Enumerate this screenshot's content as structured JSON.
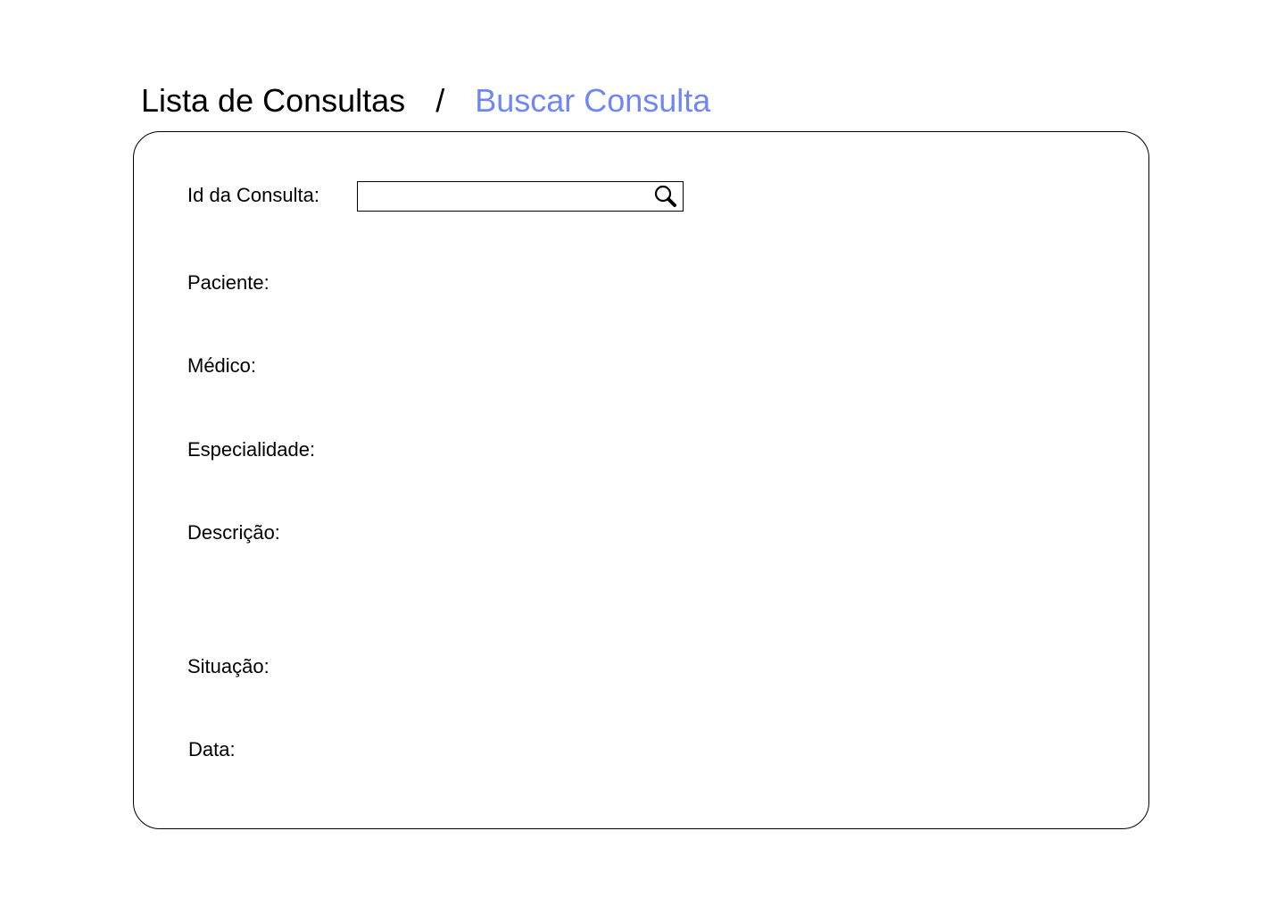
{
  "breadcrumb": {
    "root": "Lista de Consultas",
    "separator": "/",
    "current": "Buscar Consulta"
  },
  "form": {
    "id_label": "Id da Consulta:",
    "id_value": "",
    "id_placeholder": "",
    "paciente_label": "Paciente:",
    "medico_label": "Médico:",
    "especialidade_label": "Especialidade:",
    "descricao_label": "Descrição:",
    "situacao_label": "Situação:",
    "data_label": "Data:"
  },
  "icons": {
    "search": "search-icon"
  },
  "colors": {
    "accent": "#6f86f3",
    "text": "#000000",
    "border": "#000000"
  }
}
